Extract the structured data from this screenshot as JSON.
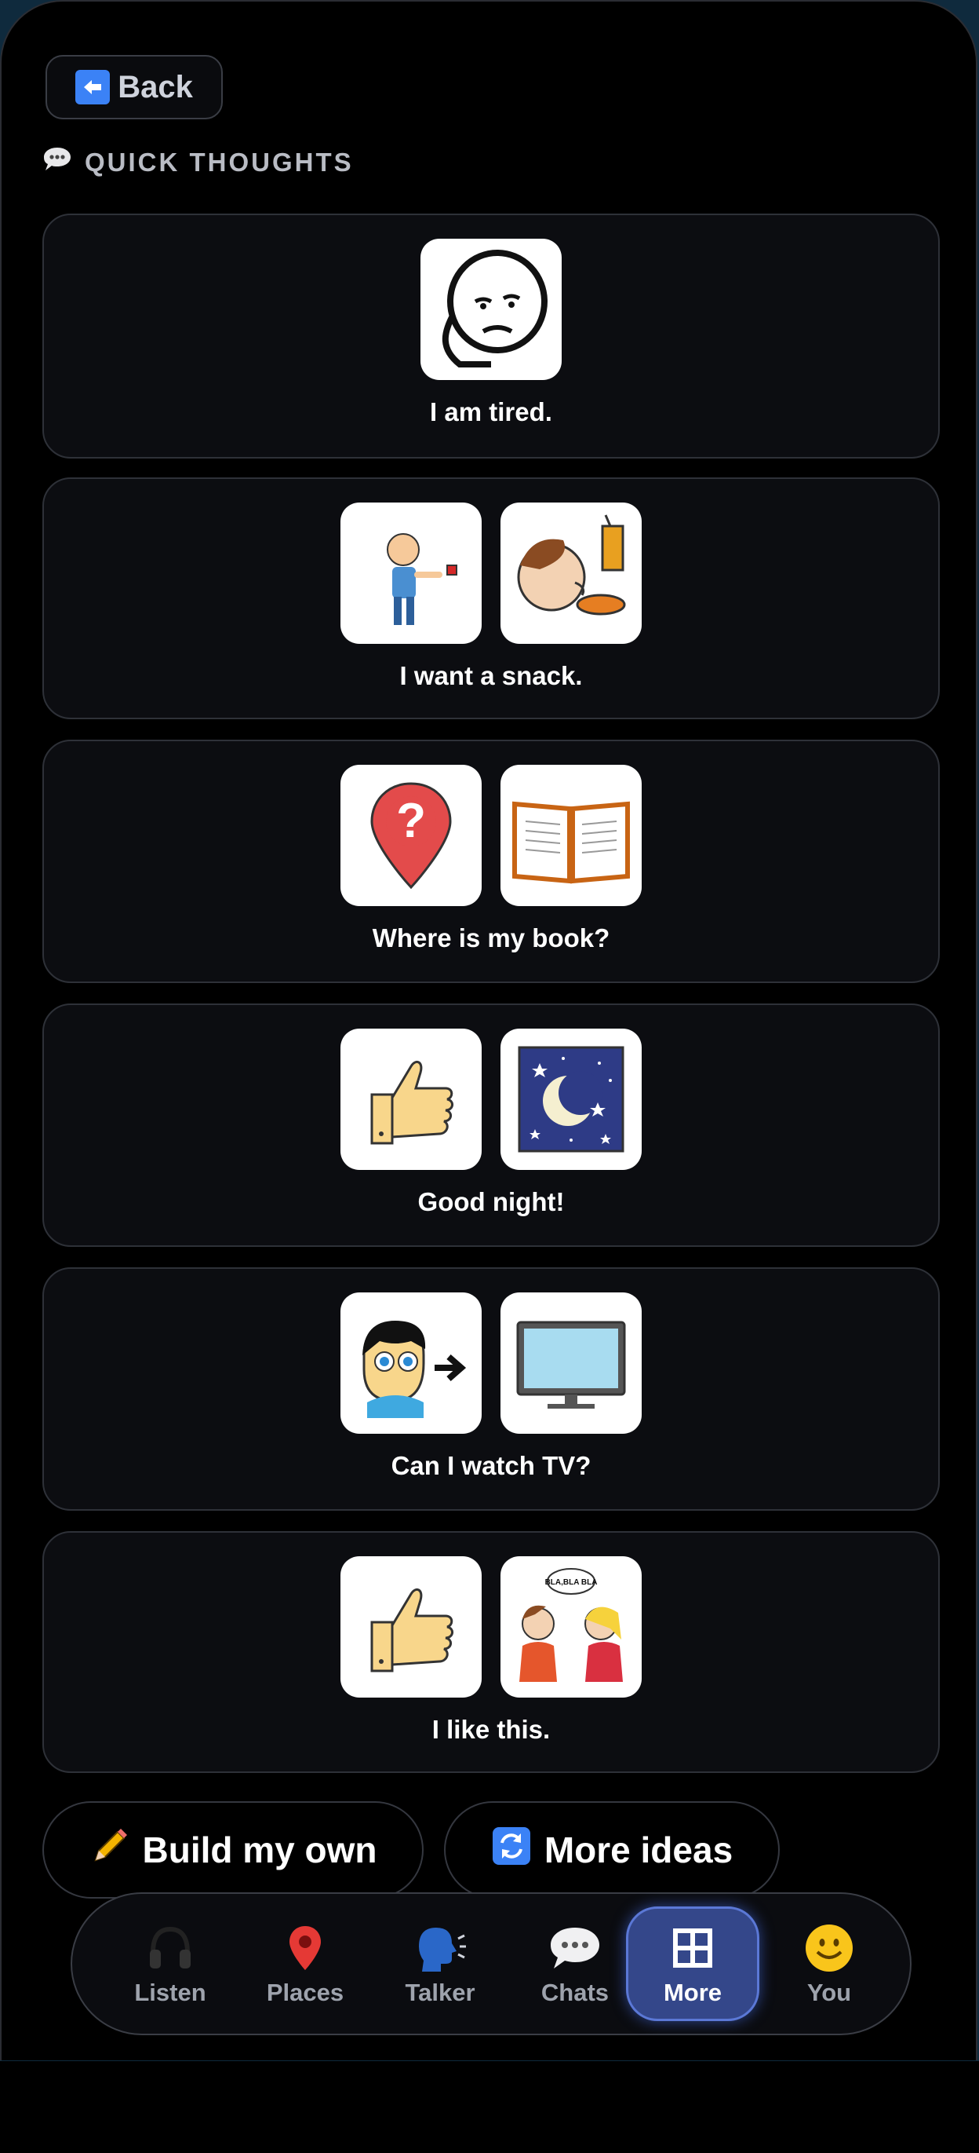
{
  "header": {
    "back_label": "Back",
    "back_icon": "left-arrow-icon"
  },
  "section": {
    "title": "QUICK THOUGHTS",
    "icon": "speech-bubble-icon"
  },
  "phrases": [
    {
      "caption": "I am tired.",
      "symbols": [
        "tired-face-icon"
      ]
    },
    {
      "caption": "I want a snack.",
      "symbols": [
        "i-want-icon",
        "snack-icon"
      ]
    },
    {
      "caption": "Where is my book?",
      "symbols": [
        "where-question-icon",
        "book-icon"
      ]
    },
    {
      "caption": "Good night!",
      "symbols": [
        "thumbs-up-icon",
        "night-moon-icon"
      ]
    },
    {
      "caption": "Can I watch TV?",
      "symbols": [
        "watch-icon",
        "tv-icon"
      ]
    },
    {
      "caption": "I like this.",
      "symbols": [
        "thumbs-up-icon",
        "people-talking-icon"
      ]
    }
  ],
  "talking_bubble_text": "BLA,BLA BLA",
  "actions": {
    "build_label": "Build my own",
    "build_icon": "pencil-icon",
    "ideas_label": "More ideas",
    "ideas_icon": "refresh-icon"
  },
  "nav": {
    "items": [
      {
        "label": "Listen",
        "icon": "headphones-icon"
      },
      {
        "label": "Places",
        "icon": "pin-icon"
      },
      {
        "label": "Talker",
        "icon": "speaking-head-icon"
      },
      {
        "label": "Chats",
        "icon": "speech-bubble-icon"
      },
      {
        "label": "More",
        "icon": "grid-icon",
        "active": true
      },
      {
        "label": "You",
        "icon": "smiley-icon"
      }
    ]
  },
  "colors": {
    "accent": "#34478a",
    "background": "#000000",
    "card": "#0c0d11"
  }
}
